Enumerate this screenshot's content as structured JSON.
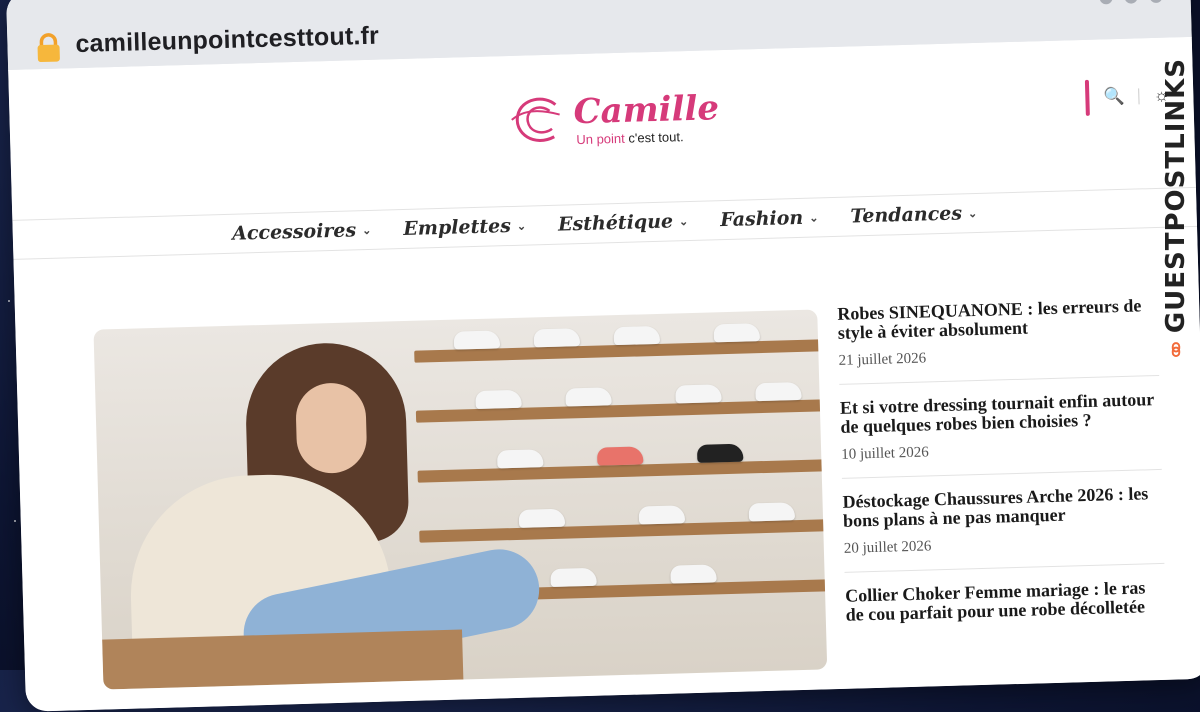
{
  "browser": {
    "url": "camilleunpointcesttout.fr"
  },
  "site": {
    "logo_name": "Camille",
    "logo_tagline_a": "Un point",
    "logo_tagline_b": "c'est tout."
  },
  "nav": {
    "items": [
      {
        "label": "Accessoires"
      },
      {
        "label": "Emplettes"
      },
      {
        "label": "Esthétique"
      },
      {
        "label": "Fashion"
      },
      {
        "label": "Tendances"
      }
    ]
  },
  "sidebar": {
    "posts": [
      {
        "title": "Robes SINEQUANONE : les erreurs de style à éviter absolument",
        "date": "21 juillet 2026"
      },
      {
        "title": "Et si votre dressing tournait enfin autour de quelques robes bien choisies ?",
        "date": "10 juillet 2026"
      },
      {
        "title": "Déstockage Chaussures Arche 2026 : les bons plans à ne pas manquer",
        "date": "20 juillet 2026"
      },
      {
        "title": "Collier Choker Femme mariage : le ras de cou parfait pour une robe décolletée",
        "date": ""
      }
    ]
  },
  "watermark": {
    "text": "GUESTPOSTLINKS"
  },
  "colors": {
    "brand": "#d63a7a",
    "watermark_accent": "#f26b3a"
  }
}
